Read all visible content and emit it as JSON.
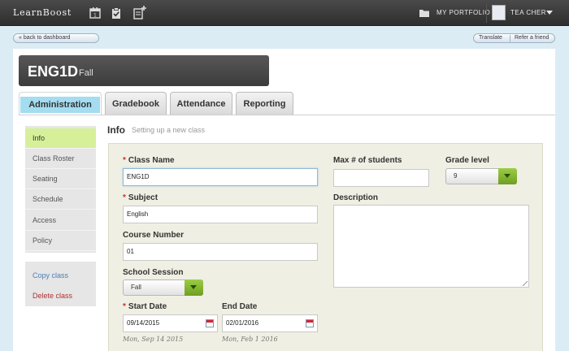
{
  "topbar": {
    "brand": "LearnBoost",
    "portfolio_label": "MY PORTFOLIO",
    "user_name": "TEA CHER"
  },
  "subbar": {
    "back_label": "« back to dashboard",
    "translate_label": "Translate",
    "refer_label": "Refer a friend"
  },
  "class_header": {
    "code": "ENG1D",
    "term": "Fall"
  },
  "tabs": [
    {
      "label": "Administration",
      "active": true
    },
    {
      "label": "Gradebook"
    },
    {
      "label": "Attendance"
    },
    {
      "label": "Reporting"
    }
  ],
  "sidebar": {
    "items": [
      {
        "label": "Info",
        "active": true
      },
      {
        "label": "Class Roster"
      },
      {
        "label": "Seating"
      },
      {
        "label": "Schedule"
      },
      {
        "label": "Access"
      },
      {
        "label": "Policy"
      }
    ],
    "copy_class": "Copy class",
    "delete_class": "Delete class"
  },
  "info": {
    "title": "Info",
    "subtitle": "Setting up a new class"
  },
  "form": {
    "class_name": {
      "label": "Class Name",
      "required": true,
      "value": "ENG1D"
    },
    "subject": {
      "label": "Subject",
      "required": true,
      "value": "English"
    },
    "course_number": {
      "label": "Course Number",
      "value": "01"
    },
    "school_session": {
      "label": "School Session",
      "value": "Fall"
    },
    "start_date": {
      "label": "Start Date",
      "required": true,
      "value": "09/14/2015",
      "hint": "Mon, Sep 14 2015"
    },
    "end_date": {
      "label": "End Date",
      "value": "02/01/2016",
      "hint": "Mon, Feb 1 2016"
    },
    "max_students": {
      "label": "Max # of students",
      "value": ""
    },
    "grade_level": {
      "label": "Grade level",
      "value": "9"
    },
    "description": {
      "label": "Description",
      "value": ""
    }
  },
  "colors": {
    "accent_green": "#8cbd3a",
    "active_tab": "#a4dcf0",
    "active_nav": "#d6f09a",
    "required": "#c9302c",
    "link_blue": "#4a7fb5",
    "link_red": "#b03030"
  }
}
